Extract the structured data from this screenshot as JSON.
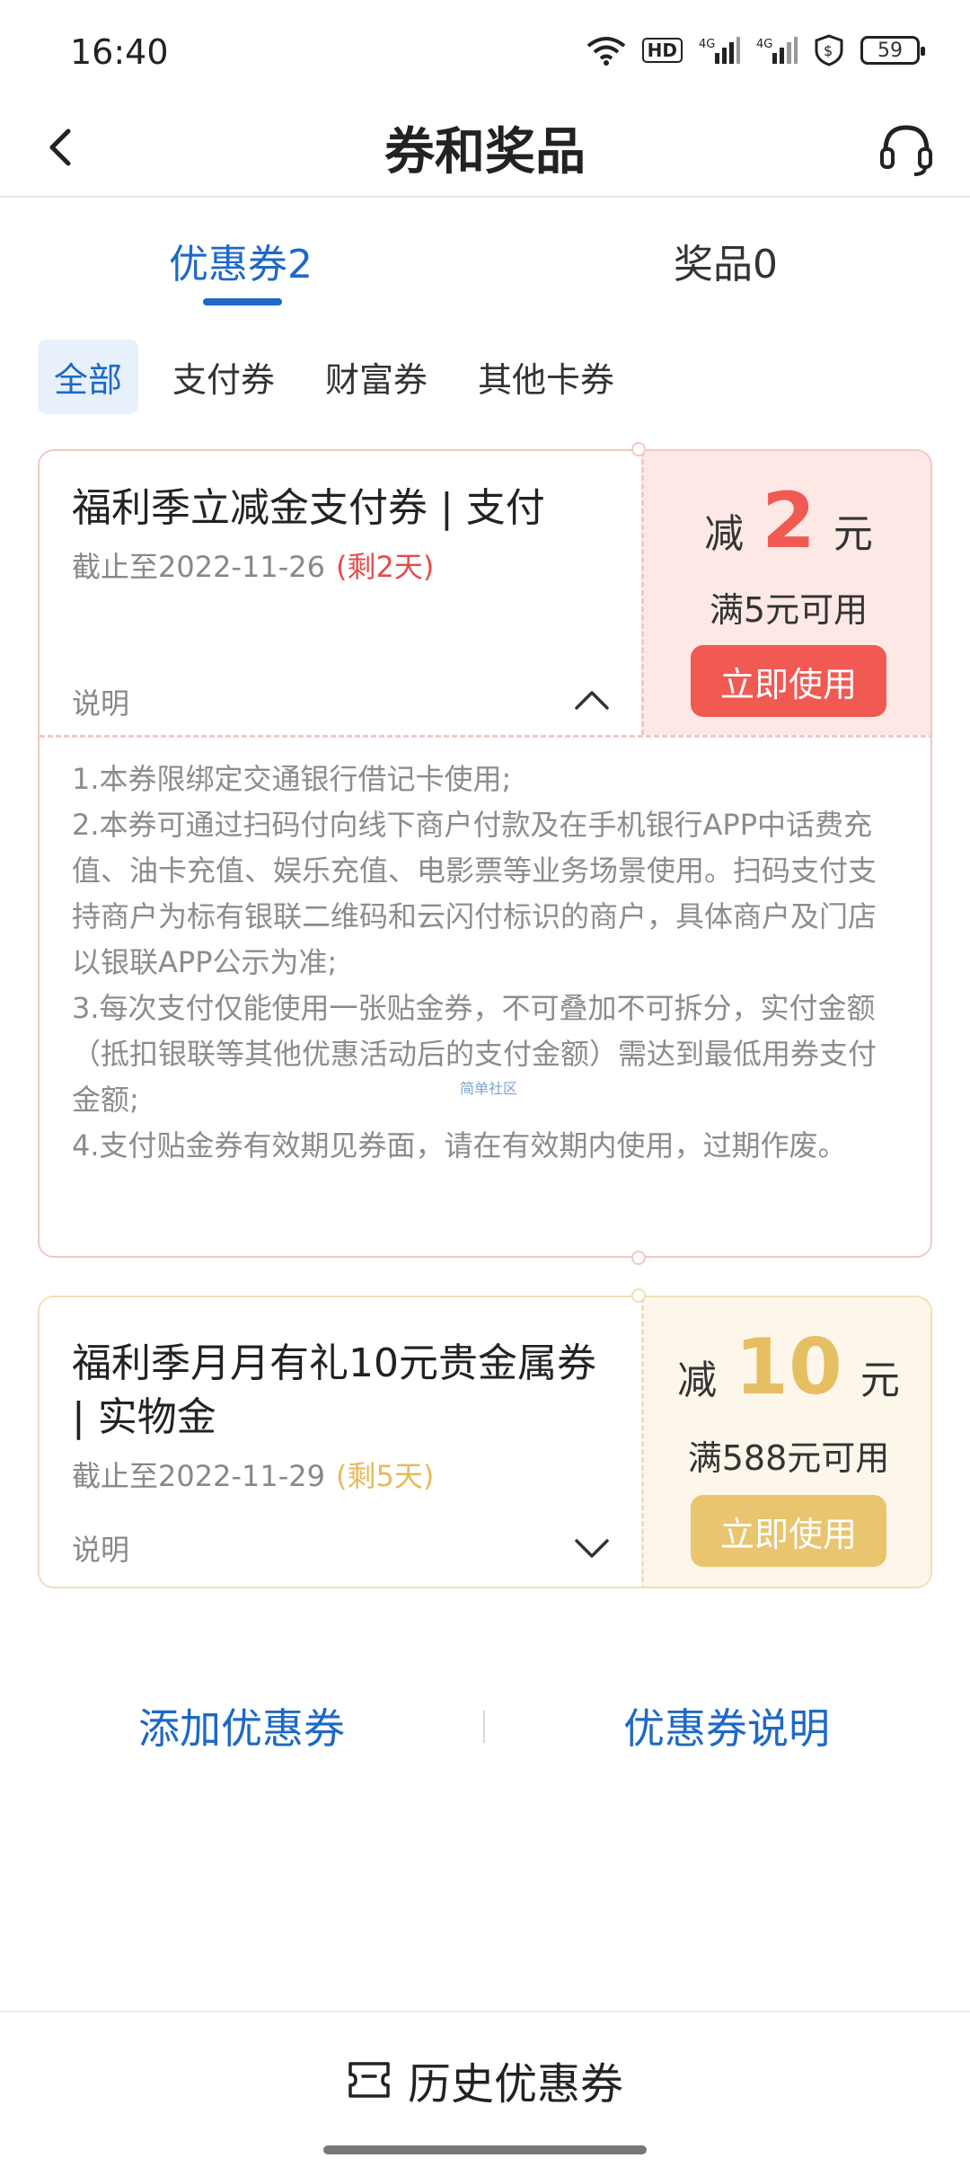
{
  "status_bar": {
    "time": "16:40",
    "battery": "59",
    "hd_label": "HD",
    "network_label": "4G"
  },
  "header": {
    "title": "券和奖品"
  },
  "tabs": [
    {
      "label": "优惠券2"
    },
    {
      "label": "奖品0"
    }
  ],
  "filters": [
    {
      "label": "全部"
    },
    {
      "label": "支付券"
    },
    {
      "label": "财富券"
    },
    {
      "label": "其他卡券"
    }
  ],
  "coupons": [
    {
      "title": "福利季立减金支付券 | 支付",
      "expire": "截止至2022-11-26",
      "remaining": "(剩2天)",
      "explain_label": "说明",
      "prefix": "减",
      "amount": "2",
      "unit": "元",
      "condition": "满5元可用",
      "button": "立即使用",
      "terms": [
        "1.本券限绑定交通银行借记卡使用;",
        "2.本券可通过扫码付向线下商户付款及在手机银行APP中话费充值、油卡充值、娱乐充值、电影票等业务场景使用。扫码支付支持商户为标有银联二维码和云闪付标识的商户，具体商户及门店以银联APP公示为准;",
        "3.每次支付仅能使用一张贴金券，不可叠加不可拆分，实付金额（抵扣银联等其他优惠活动后的支付金额）需达到最低用券支付金额;",
        "4.支付贴金券有效期见券面，请在有效期内使用，过期作废。"
      ],
      "watermark": "简单社区"
    },
    {
      "title": "福利季月月有礼10元贵金属券 | 实物金",
      "expire": "截止至2022-11-29",
      "remaining": "(剩5天)",
      "explain_label": "说明",
      "prefix": "减",
      "amount": "10",
      "unit": "元",
      "condition": "满588元可用",
      "button": "立即使用"
    }
  ],
  "links": {
    "add": "添加优惠券",
    "info": "优惠券说明"
  },
  "footer": {
    "history": "历史优惠券"
  },
  "colors": {
    "accent": "#1d68c8",
    "red": "#f05a52",
    "gold": "#e6bf62"
  }
}
